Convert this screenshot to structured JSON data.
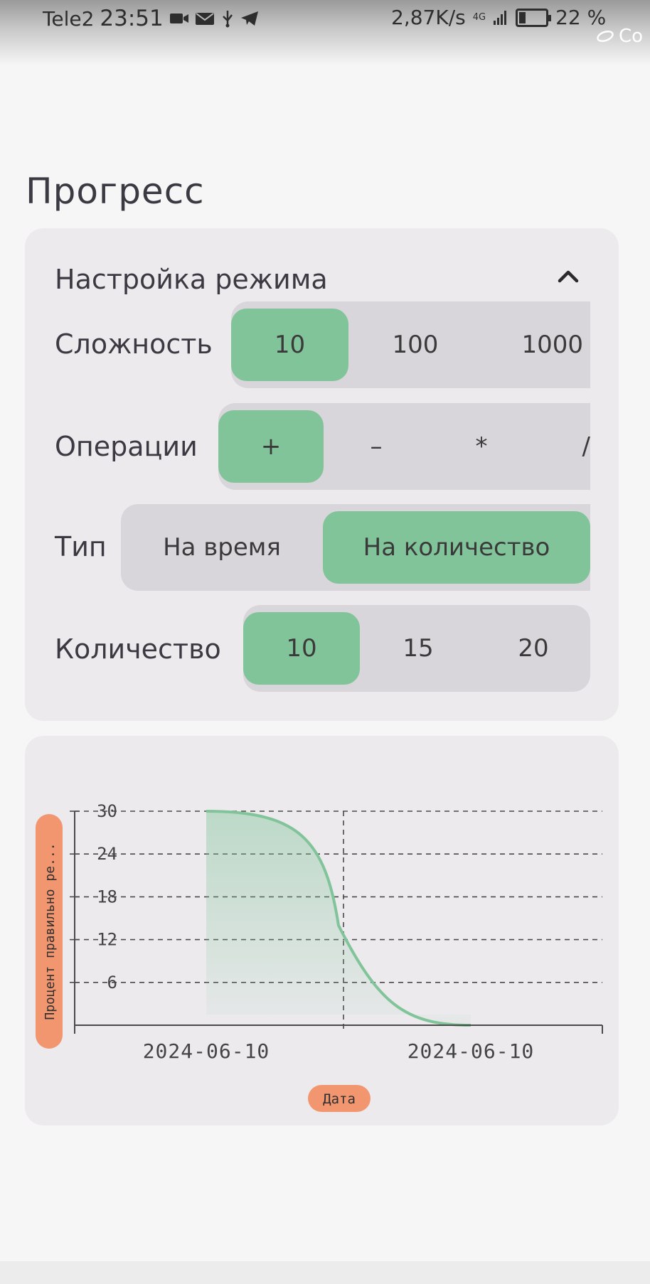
{
  "status_bar": {
    "carrier": "Tele2",
    "time": "23:51",
    "net_speed": "2,87K/s",
    "network_type": "4G",
    "battery": "22 %",
    "battery_level": 0.22,
    "edge_text": "Co",
    "icons": [
      "video-icon",
      "mail-icon",
      "usb-icon",
      "telegram-icon",
      "signal-icon",
      "battery-icon"
    ]
  },
  "page": {
    "title": "Прогресс"
  },
  "settings": {
    "title": "Настройка режима",
    "difficulty": {
      "label": "Сложность",
      "options": [
        "10",
        "100",
        "1000"
      ],
      "selected": 0
    },
    "operations": {
      "label": "Операции",
      "options": [
        "+",
        "–",
        "*",
        "/"
      ],
      "selected": 0
    },
    "type": {
      "label": "Тип",
      "options": [
        "На время",
        "На количество"
      ],
      "selected": 1
    },
    "quantity": {
      "label": "Количество",
      "options": [
        "10",
        "15",
        "20"
      ],
      "selected": 0
    }
  },
  "colors": {
    "accent": "#82c49a",
    "badge": "#f29670",
    "card": "#eceaed",
    "segment": "#d8d6da"
  },
  "chart_data": {
    "type": "area",
    "ylabel": "Процент правильно ре...",
    "xlabel": "Дата",
    "x_ticks": [
      "2024-06-10",
      "2024-06-10"
    ],
    "y_ticks": [
      6,
      12,
      18,
      24,
      30
    ],
    "ylim": [
      0,
      30
    ],
    "x": [
      0,
      0.5,
      1
    ],
    "series": [
      {
        "values": [
          30,
          14,
          0
        ]
      }
    ],
    "grid": true
  }
}
